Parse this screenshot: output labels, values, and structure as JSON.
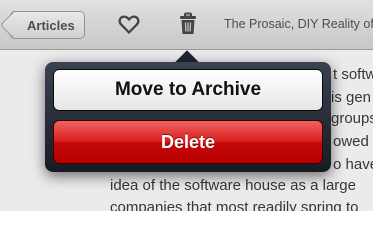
{
  "toolbar": {
    "back_label": "Articles",
    "heart_icon": "heart-icon",
    "trash_icon": "trash-icon",
    "page_title": "The Prosaic, DIY Reality of"
  },
  "article": {
    "lines": [
      "t softw",
      "is gen",
      "groups",
      "owed",
      "o have",
      "idea of the software house as a large",
      "companies that most readily spring to"
    ]
  },
  "popover": {
    "archive_label": "Move to Archive",
    "delete_label": "Delete",
    "delete_color": "#c80000"
  }
}
